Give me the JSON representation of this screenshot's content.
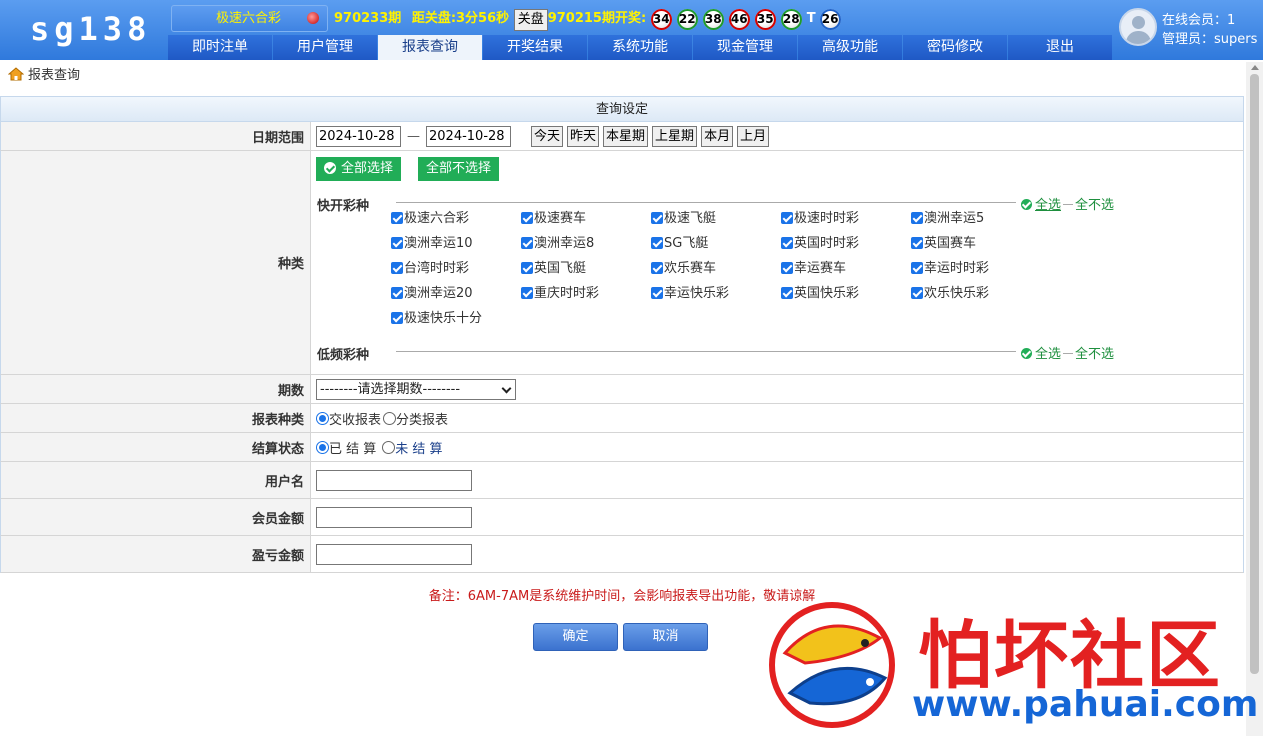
{
  "header": {
    "logo": "sg138",
    "lottery_select": "极速六合彩",
    "period": "970233期",
    "close_countdown": "距关盘:3分56秒",
    "close_button": "关盘",
    "draw_label": "970215期开奖:",
    "balls": [
      {
        "num": "34",
        "color": "red"
      },
      {
        "num": "22",
        "color": "green"
      },
      {
        "num": "38",
        "color": "green"
      },
      {
        "num": "46",
        "color": "red"
      },
      {
        "num": "35",
        "color": "red"
      },
      {
        "num": "28",
        "color": "green"
      }
    ],
    "special_label": "T",
    "special_ball": {
      "num": "26",
      "color": "blue"
    },
    "online_members": "在线会员：1",
    "admin": "管理员：supers"
  },
  "nav": [
    "即时注单",
    "用户管理",
    "报表查询",
    "开奖结果",
    "系统功能",
    "现金管理",
    "高级功能",
    "密码修改",
    "退出"
  ],
  "nav_active": 2,
  "breadcrumb": "报表查询",
  "form": {
    "title": "查询设定",
    "date_label": "日期范围",
    "date_from": "2024-10-28",
    "date_sep": "—",
    "date_to": "2024-10-28",
    "quick_dates": [
      "今天",
      "昨天",
      "本星期",
      "上星期",
      "本月",
      "上月"
    ],
    "type_label": "种类",
    "select_all_btn": "全部选择",
    "select_none_btn": "全部不选择",
    "group_fast": "快开彩种",
    "group_slow": "低频彩种",
    "op_all": "全选",
    "op_none": "全不选",
    "fast_lotteries": [
      "极速六合彩",
      "极速赛车",
      "极速飞艇",
      "极速时时彩",
      "澳洲幸运5",
      "澳洲幸运10",
      "澳洲幸运8",
      "SG飞艇",
      "英国时时彩",
      "英国赛车",
      "台湾时时彩",
      "英国飞艇",
      "欢乐赛车",
      "幸运赛车",
      "幸运时时彩",
      "澳洲幸运20",
      "重庆时时彩",
      "幸运快乐彩",
      "英国快乐彩",
      "欢乐快乐彩",
      "极速快乐十分"
    ],
    "period_label": "期数",
    "period_select": "--------请选择期数--------",
    "report_type_label": "报表种类",
    "report_type_options": [
      "交收报表",
      "分类报表"
    ],
    "settle_label": "结算状态",
    "settle_options": [
      "已 结 算",
      "未 结 算"
    ],
    "username_label": "用户名",
    "member_amount_label": "会员金额",
    "profit_amount_label": "盈亏金额",
    "note": "备注：6AM-7AM是系统维护时间，会影响报表导出功能，敬请谅解",
    "confirm": "确定",
    "cancel": "取消"
  },
  "watermark": {
    "title": "怕坏社区",
    "url": "www.pahuai.com"
  }
}
